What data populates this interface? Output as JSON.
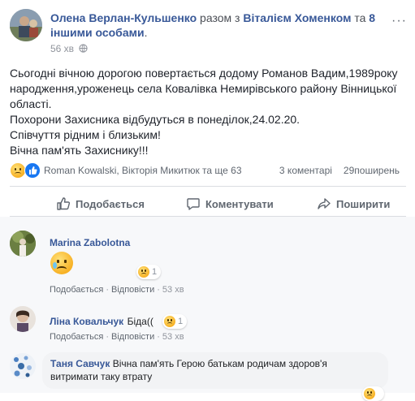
{
  "post": {
    "author": "Олена Верлан-Кульшенко",
    "with_text": " разом з ",
    "tagged": "Віталієм Хоменком",
    "and_text": " та ",
    "others": "8 іншими особами",
    "others_suffix": ".",
    "time": "56 хв",
    "more": "···",
    "lines": [
      "Сьогодні вічною дорогою повертається додому Романов Вадим,1989року",
      "народження,уроженець села Ковалівка Немирівського району Вінницької",
      "області.",
      "Похорони Захисника відбудуться в понеділок,24.02.20.",
      "Співчуття рідним і близьким!",
      "Вічна пам'ять Захиснику!!!"
    ]
  },
  "summary": {
    "reactors": "Roman Kowalski, Вікторія Микитюк та ще 63",
    "comments": "3 коментарі",
    "shares": "29поширень"
  },
  "actions": {
    "like": "Подобається",
    "comment": "Коментувати",
    "share": "Поширити"
  },
  "comments": [
    {
      "name": "Marina Zabolotna",
      "text": "",
      "reaction_count": "1",
      "like": "Подобається",
      "reply": "Відповісти",
      "time": "53 хв"
    },
    {
      "name": "Ліна Ковальчук",
      "text": "Біда((",
      "reaction_count": "1",
      "like": "Подобається",
      "reply": "Відповісти",
      "time": "53 хв"
    },
    {
      "name": "Таня Савчук",
      "text": "Вічна пам'ять Герою батькам родичам здоров'я",
      "text2": "витримати таку втрату"
    }
  ],
  "colors": {
    "link": "#385898",
    "like_blue": "#1877f2",
    "muted": "#606770"
  }
}
